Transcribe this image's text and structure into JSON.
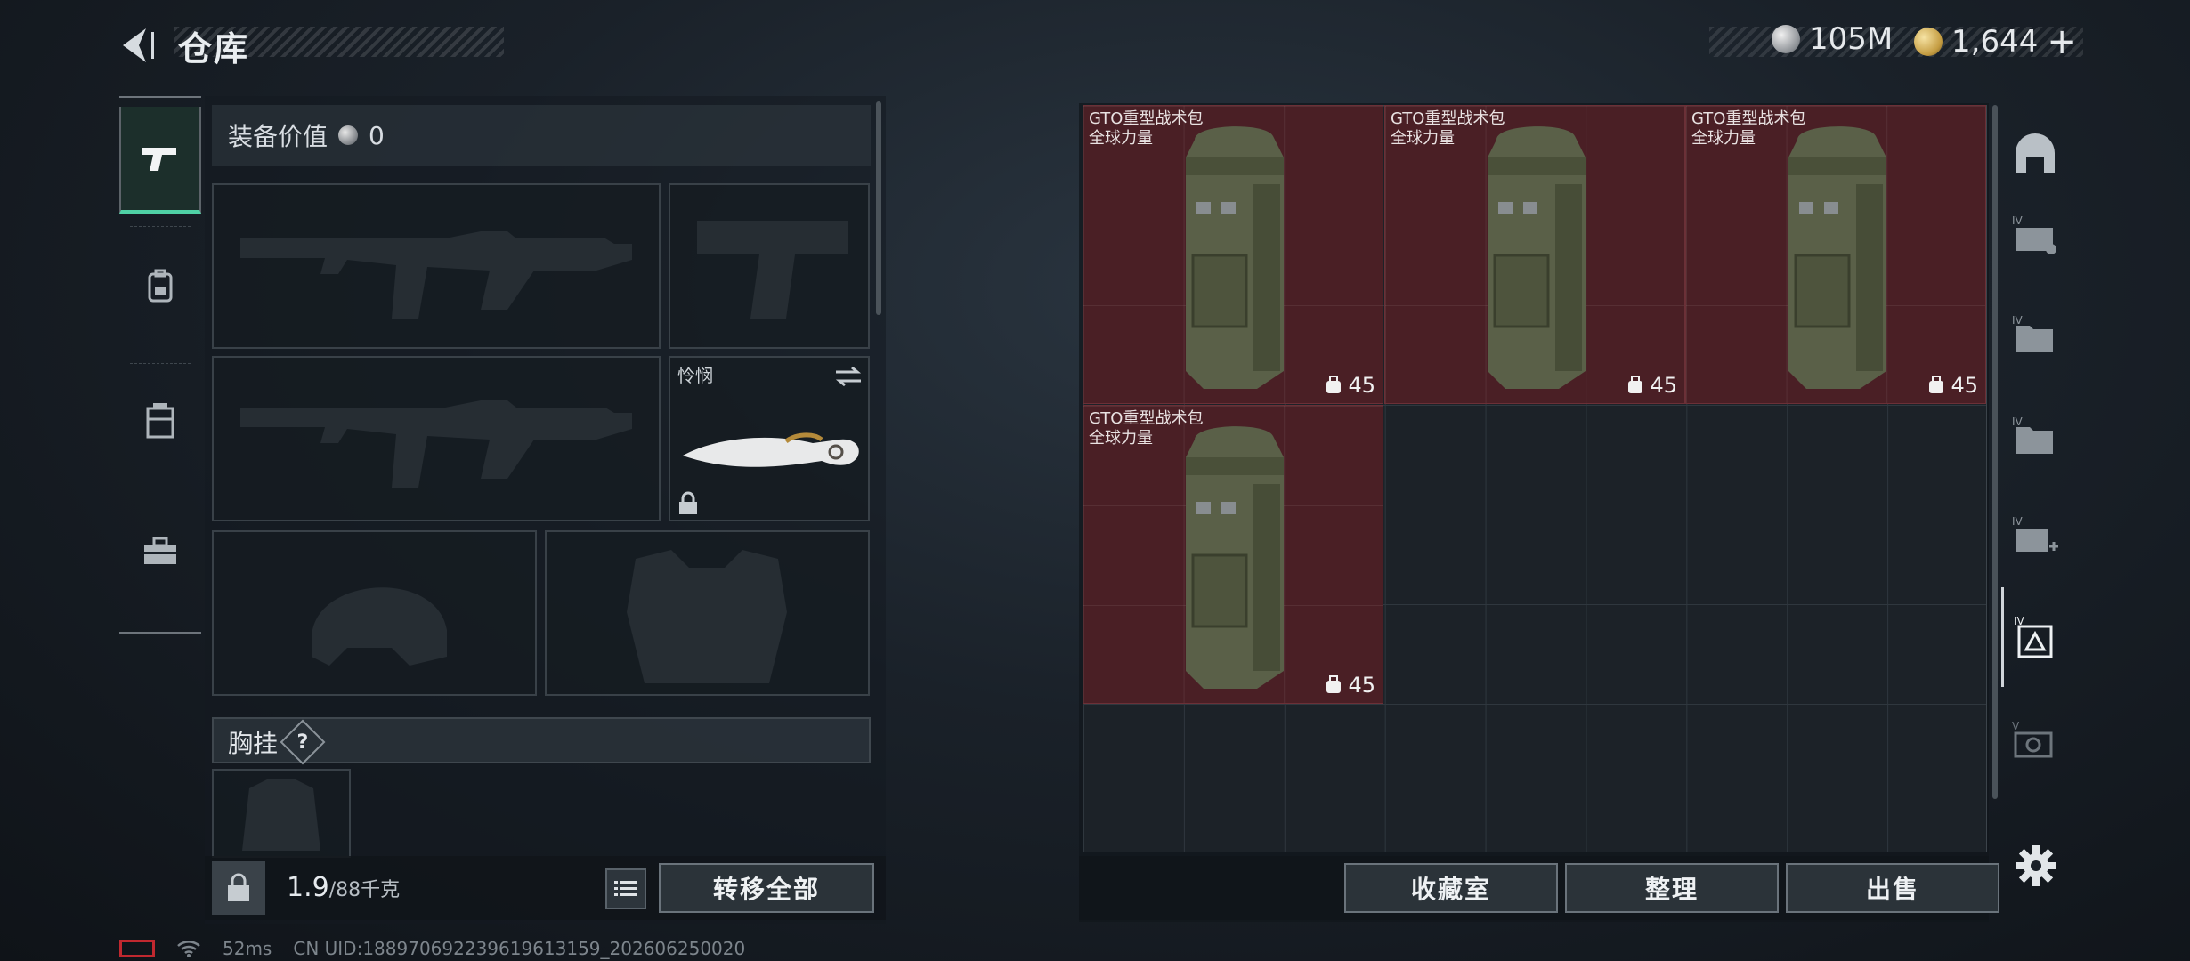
{
  "header": {
    "title": "仓库",
    "currency_silver": "105M",
    "currency_gold": "1,644",
    "add_symbol": "+"
  },
  "left_nav": {
    "items": [
      {
        "icon": "pistol-icon",
        "active": true
      },
      {
        "icon": "backpack-icon",
        "active": false
      },
      {
        "icon": "chest-rig-icon",
        "active": false
      },
      {
        "icon": "toolbox-icon",
        "active": false
      }
    ]
  },
  "equipment": {
    "value_label": "装备价值",
    "value": "0",
    "melee_name": "怜悯",
    "chest_rig_label": "胸挂",
    "help_symbol": "?",
    "weight_current": "1.9",
    "weight_max": "/88千克",
    "transfer_all_label": "转移全部"
  },
  "grid": {
    "items": [
      {
        "name_line1": "GTO重型战术包",
        "name_line2": "全球力量",
        "count": "45"
      },
      {
        "name_line1": "GTO重型战术包",
        "name_line2": "全球力量",
        "count": "45"
      },
      {
        "name_line1": "GTO重型战术包",
        "name_line2": "全球力量",
        "count": "45"
      },
      {
        "name_line1": "GTO重型战术包",
        "name_line2": "全球力量",
        "count": "45"
      }
    ],
    "item_color": "#4a1f25"
  },
  "actions": {
    "collection_label": "收藏室",
    "sort_label": "整理",
    "sell_label": "出售"
  },
  "right_nav": {
    "items": [
      "hideout-icon",
      "tier4-case-icon",
      "tier4-folder-icon",
      "tier4-folder-2-icon",
      "tier4-medkit-icon",
      "tier4-backpack-icon",
      "tier5-safe-icon"
    ]
  },
  "status": {
    "ping": "52ms",
    "uid": "CN UID:18897069223961961315​9_202606250020"
  }
}
